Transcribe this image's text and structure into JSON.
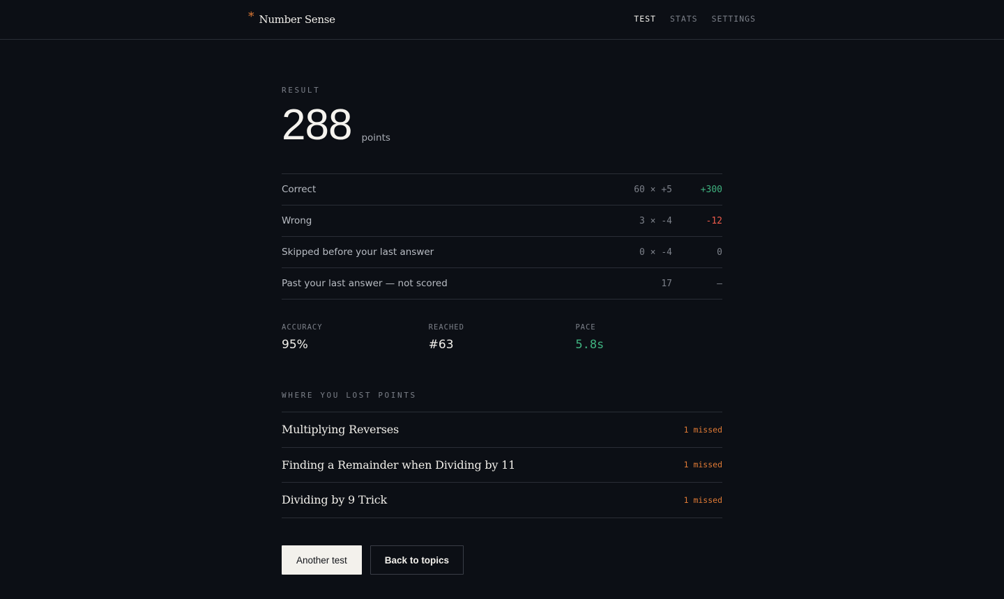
{
  "header": {
    "brand_mark": "*",
    "brand_name": "Number Sense",
    "nav": [
      {
        "label": "TEST",
        "active": true
      },
      {
        "label": "STATS",
        "active": false
      },
      {
        "label": "SETTINGS",
        "active": false
      }
    ]
  },
  "result": {
    "label": "RESULT",
    "score": "288",
    "unit": "points"
  },
  "breakdown": [
    {
      "label": "Correct",
      "calc": "60 × +5",
      "value": "+300",
      "color": "#3fb27f"
    },
    {
      "label": "Wrong",
      "calc": "3 × -4",
      "value": "-12",
      "color": "#ef5b4b"
    },
    {
      "label": "Skipped before your last answer",
      "calc": "0 × -4",
      "value": "0",
      "color": "#7c8089"
    },
    {
      "label": "Past your last answer — not scored",
      "calc": "17",
      "value": "—",
      "color": "#7c8089"
    }
  ],
  "stats": {
    "accuracy": {
      "label": "ACCURACY",
      "value": "95%"
    },
    "reached": {
      "label": "REACHED",
      "value": "#63"
    },
    "pace": {
      "label": "PACE",
      "value": "5.8s",
      "color": "#3fb27f"
    }
  },
  "lost": {
    "label": "WHERE YOU LOST POINTS",
    "items": [
      {
        "title": "Multiplying Reverses",
        "missed": "1 missed"
      },
      {
        "title": "Finding a Remainder when Dividing by 11",
        "missed": "1 missed"
      },
      {
        "title": "Dividing by 9 Trick",
        "missed": "1 missed"
      }
    ],
    "missed_color": "#e07a35"
  },
  "actions": {
    "primary": "Another test",
    "secondary": "Back to topics"
  }
}
